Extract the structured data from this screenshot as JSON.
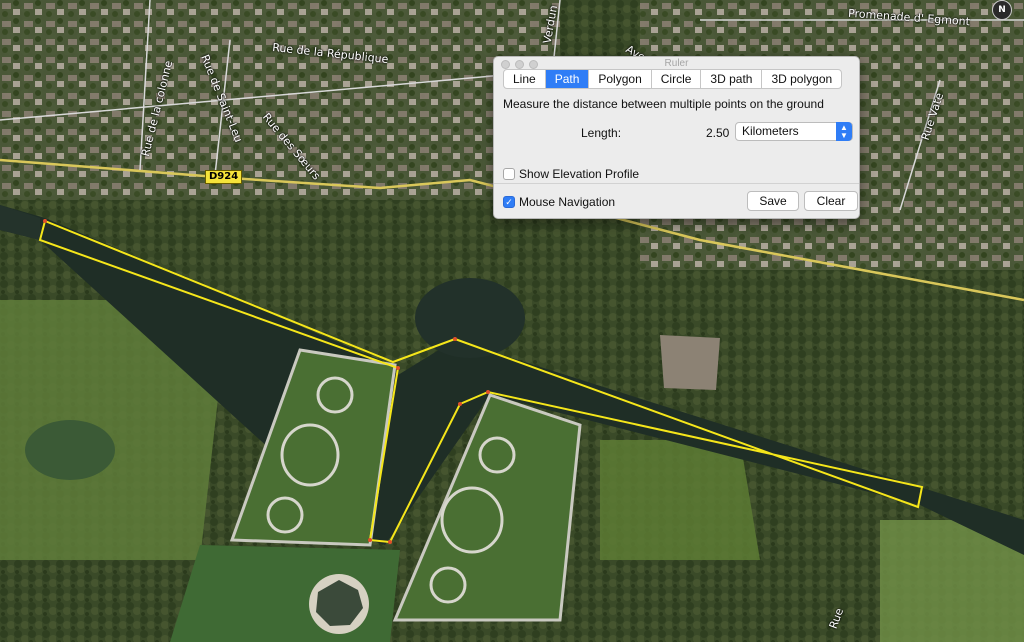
{
  "map": {
    "labels": {
      "rue_republique": "Rue de la République",
      "verdun": "Verdun",
      "avenue": "Avenue",
      "promenade": "Promenade d' Egmont",
      "rue_colonne": "Rue de la colonne",
      "rue_saint_leu": "Rue de Saint-Leu",
      "rue_soeurs": "Rue des Sœurs",
      "rue_vate": "Rue Vate",
      "road_badge": "D924",
      "rue_bottom": "Rue"
    },
    "compass": "N",
    "measure_line_color": "#f5e61a"
  },
  "ruler": {
    "window_title": "Ruler",
    "tabs": [
      "Line",
      "Path",
      "Polygon",
      "Circle",
      "3D path",
      "3D polygon"
    ],
    "active_tab": "Path",
    "description": "Measure the distance between multiple points on the ground",
    "length_label": "Length:",
    "length_value": "2.50",
    "unit_selected": "Kilometers",
    "show_elevation_label": "Show Elevation Profile",
    "show_elevation_checked": false,
    "mouse_nav_label": "Mouse Navigation",
    "mouse_nav_checked": true,
    "save_label": "Save",
    "clear_label": "Clear",
    "accent_color": "#2f7df6"
  }
}
